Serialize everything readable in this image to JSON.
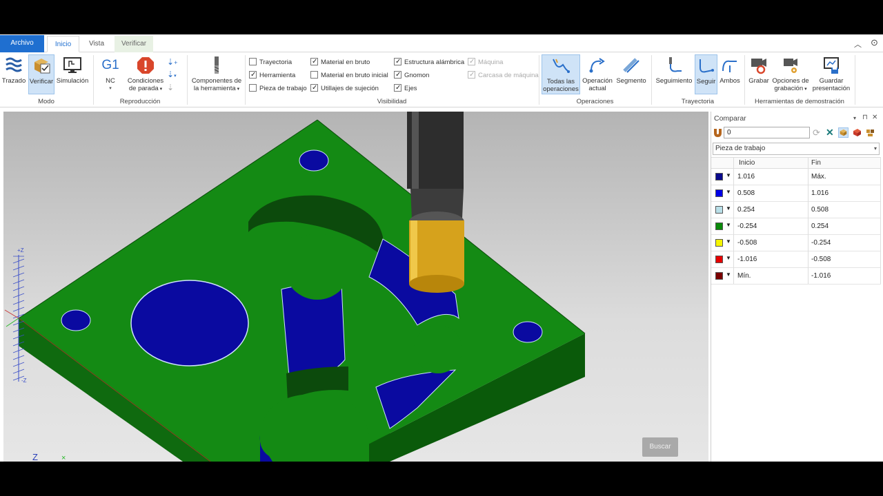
{
  "tabs": {
    "archivo": "Archivo",
    "inicio": "Inicio",
    "vista": "Vista",
    "verificar": "Verificar"
  },
  "ribbon": {
    "modo": {
      "label": "Modo",
      "trazado": "Trazado",
      "verificar": "Verificar",
      "simulacion": "Simulación"
    },
    "reproduccion": {
      "label": "Reproducción",
      "nc": "NC",
      "g1": "G1",
      "condiciones": "Condiciones",
      "de_parada": "de parada"
    },
    "componentes": {
      "line1": "Componentes de",
      "line2": "la herramienta"
    },
    "visibilidad": {
      "label": "Visibilidad",
      "items": [
        {
          "label": "Trayectoria",
          "checked": false,
          "disabled": false
        },
        {
          "label": "Herramienta",
          "checked": true,
          "disabled": false
        },
        {
          "label": "Pieza de trabajo",
          "checked": false,
          "disabled": false
        },
        {
          "label": "Material en bruto",
          "checked": true,
          "disabled": false
        },
        {
          "label": "Material en bruto inicial",
          "checked": false,
          "disabled": false
        },
        {
          "label": "Utillajes de sujeción",
          "checked": true,
          "disabled": false
        },
        {
          "label": "Estructura alámbrica",
          "checked": true,
          "disabled": false
        },
        {
          "label": "Gnomon",
          "checked": true,
          "disabled": false
        },
        {
          "label": "Ejes",
          "checked": true,
          "disabled": false
        },
        {
          "label": "Máquina",
          "checked": true,
          "disabled": true
        },
        {
          "label": "Carcasa de máquina",
          "checked": true,
          "disabled": true
        }
      ]
    },
    "operaciones": {
      "label": "Operaciones",
      "todas_1": "Todas las",
      "todas_2": "operaciones",
      "actual_1": "Operación",
      "actual_2": "actual",
      "segmento": "Segmento"
    },
    "trayectoria": {
      "label": "Trayectoria",
      "seguimiento": "Seguimiento",
      "seguir": "Seguir",
      "ambos": "Ambos"
    },
    "demo": {
      "label": "Herramientas de demostración",
      "grabar": "Grabar",
      "opciones_1": "Opciones de",
      "opciones_2": "grabación",
      "guardar_1": "Guardar",
      "guardar_2": "presentación"
    }
  },
  "viewport": {
    "buscar": "Buscar",
    "axis_top": "+Z",
    "axis_bottom": "-Z",
    "gnomon_z": "Z"
  },
  "panel": {
    "title": "Comparar",
    "value": "0",
    "dropdown": "Pieza de trabajo",
    "col_inicio": "Inicio",
    "col_fin": "Fin",
    "rows": [
      {
        "color": "#0a0a8c",
        "inicio": "1.016",
        "fin": "Máx."
      },
      {
        "color": "#0000e6",
        "inicio": "0.508",
        "fin": "1.016"
      },
      {
        "color": "#b9dfe8",
        "inicio": "0.254",
        "fin": "0.508"
      },
      {
        "color": "#0a8a0a",
        "inicio": "-0.254",
        "fin": "0.254"
      },
      {
        "color": "#f5f500",
        "inicio": "-0.508",
        "fin": "-0.254"
      },
      {
        "color": "#e60000",
        "inicio": "-1.016",
        "fin": "-0.508"
      },
      {
        "color": "#7a0000",
        "inicio": "Mín.",
        "fin": "-1.016"
      }
    ]
  }
}
